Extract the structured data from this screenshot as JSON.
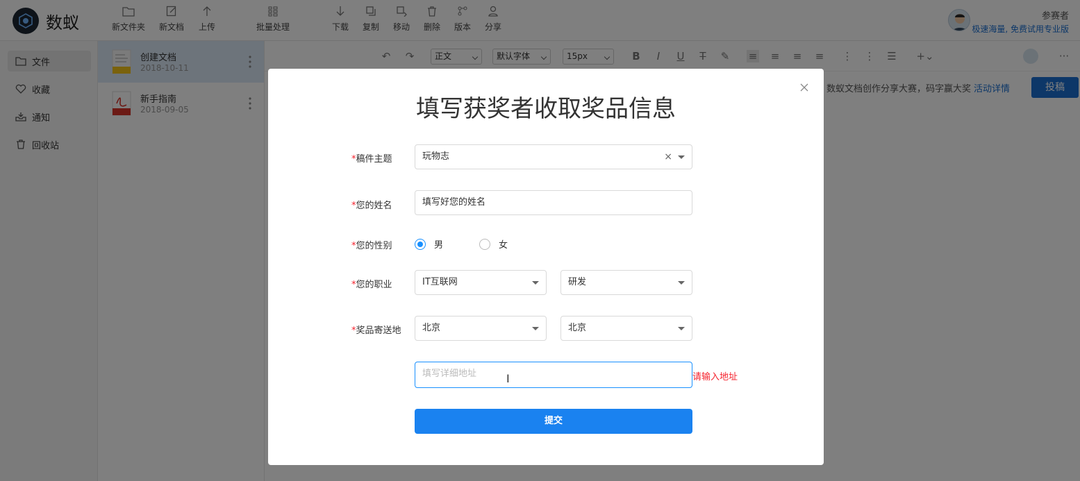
{
  "app": {
    "name": "数蚁",
    "colors": {
      "accent": "#1a82f0",
      "error": "#f5222d",
      "brand_dark": "#1c2733"
    }
  },
  "toolbar": {
    "new_folder": "新文件夹",
    "new_doc": "新文档",
    "upload": "上传",
    "batch": "批量处理",
    "download": "下载",
    "copy": "复制",
    "move": "移动",
    "delete": "删除",
    "version": "版本",
    "share": "分享"
  },
  "user": {
    "name": "参赛者",
    "promo": "极速海量, 免费试用专业版"
  },
  "sidebar": {
    "items": [
      {
        "label": "文件",
        "icon": "folder-icon"
      },
      {
        "label": "收藏",
        "icon": "heart-icon"
      },
      {
        "label": "通知",
        "icon": "inbox-icon"
      },
      {
        "label": "回收站",
        "icon": "trash-icon"
      }
    ]
  },
  "files": [
    {
      "name": "创建文档",
      "date": "2018-10-11",
      "type": "NOTE"
    },
    {
      "name": "新手指南",
      "date": "2018-09-05",
      "type": "PDF"
    }
  ],
  "editor": {
    "style": "正文",
    "font": "默认字体",
    "size": "15px",
    "banner": "数蚁文档创作分享大赛，码字赢大奖",
    "banner_link": "活动详情",
    "post": "投稿"
  },
  "modal": {
    "title": "填写获奖者收取奖品信息",
    "fields": {
      "topic_label": "稿件主题",
      "topic_value": "玩物志",
      "name_label": "您的姓名",
      "name_value": "填写好您的姓名",
      "gender_label": "您的性别",
      "gender_male": "男",
      "gender_female": "女",
      "job_label": "您的职业",
      "job_industry": "IT互联网",
      "job_role": "研发",
      "address_label": "奖品寄送地",
      "province": "北京",
      "city": "北京",
      "address_placeholder": "填写详细地址",
      "address_error": "请输入地址"
    },
    "submit": "提交"
  }
}
